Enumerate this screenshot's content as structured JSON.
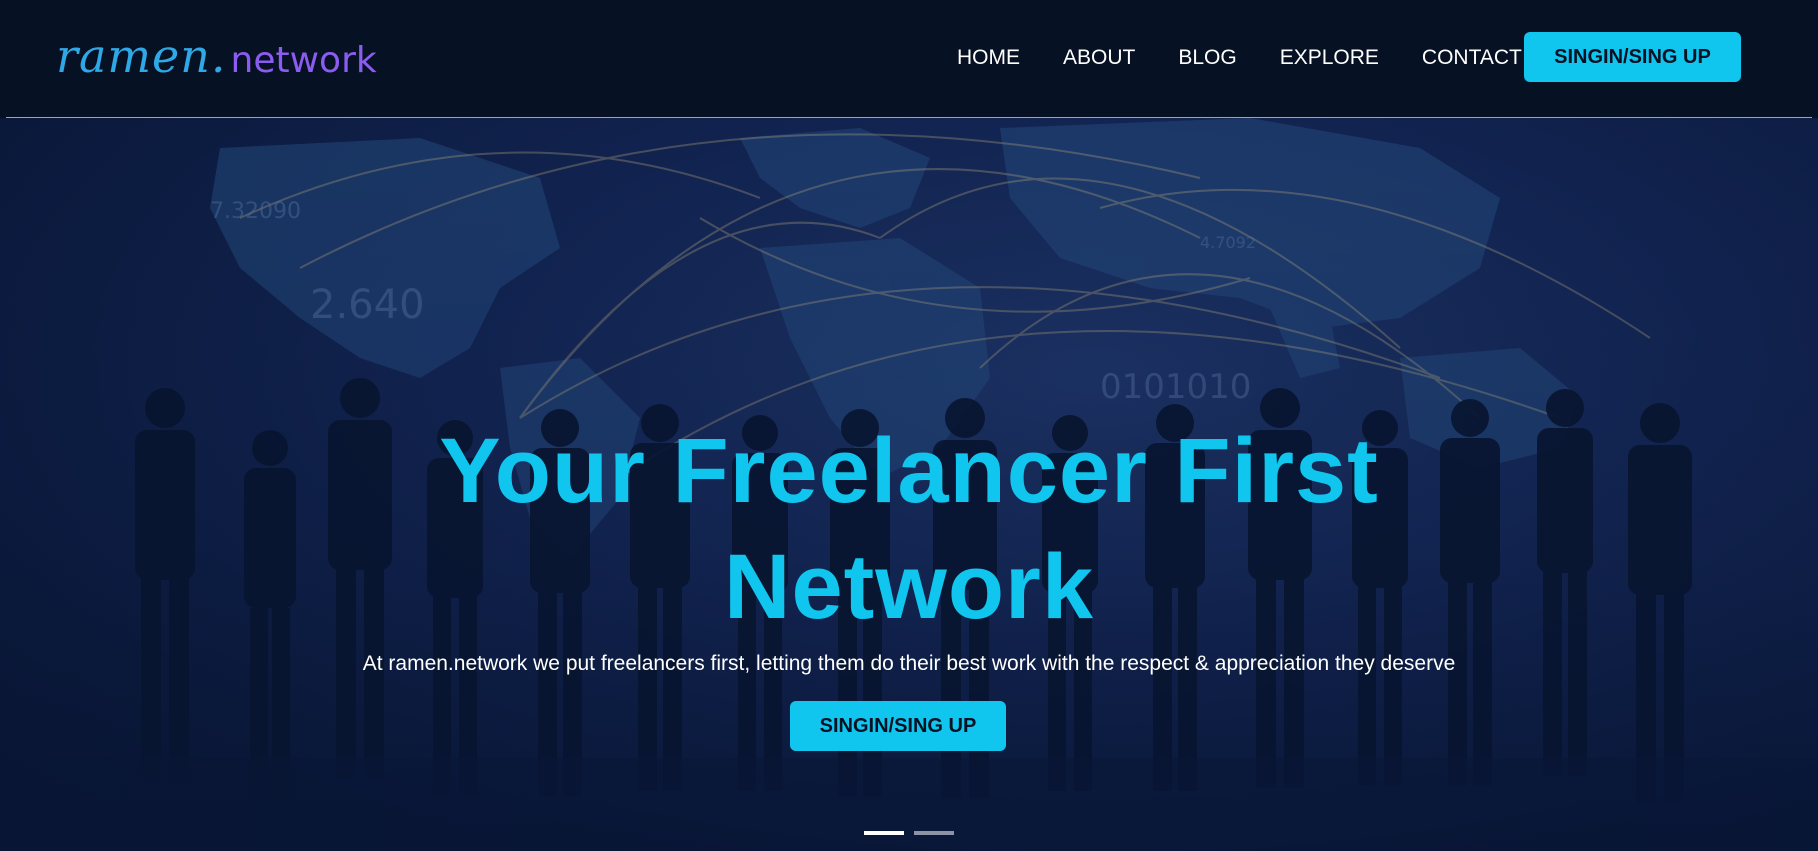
{
  "logo": {
    "script_text": "ramen.",
    "network_text": "network"
  },
  "nav": {
    "items": [
      {
        "label": "HOME"
      },
      {
        "label": "ABOUT"
      },
      {
        "label": "BLOG"
      },
      {
        "label": "EXPLORE"
      },
      {
        "label": "CONTACT"
      }
    ],
    "cta_label": "SINGIN/SING UP"
  },
  "hero": {
    "title_line1": "Your Freelancer First",
    "title_line2": "Network",
    "subtitle": "At ramen.network we put freelancers first, letting them do their best work with the respect & appreciation they deserve",
    "cta_label": "SINGIN/SING UP",
    "slides": [
      {
        "active": true
      },
      {
        "active": false
      }
    ]
  },
  "colors": {
    "background": "#071124",
    "accent": "#11c6ee",
    "logo_script": "#2fa8e6",
    "logo_network": "#8a5cf0"
  }
}
